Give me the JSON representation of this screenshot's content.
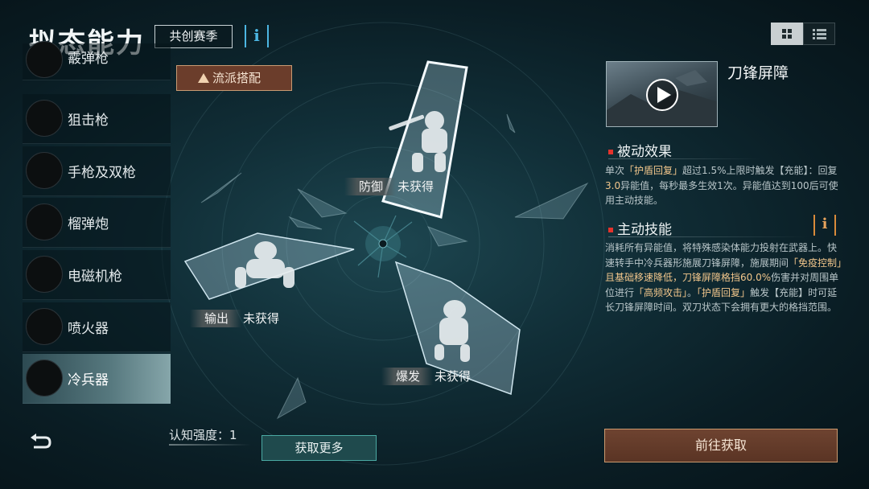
{
  "header": {
    "title": "拟态能力",
    "season_badge": "共创赛季",
    "info_icon": "info-icon"
  },
  "view_toggle": {
    "grid_icon": "grid-icon",
    "list_icon": "list-icon",
    "selected": "grid"
  },
  "sidebar": {
    "items": [
      {
        "label": "霰弹枪",
        "icon": "shotgun-icon",
        "active": false
      },
      {
        "label": "狙击枪",
        "icon": "sniper-rifle-icon",
        "active": false
      },
      {
        "label": "手枪及双枪",
        "icon": "dual-pistol-icon",
        "active": false
      },
      {
        "label": "榴弹炮",
        "icon": "grenade-launcher-icon",
        "active": false
      },
      {
        "label": "电磁机枪",
        "icon": "railgun-icon",
        "active": false
      },
      {
        "label": "喷火器",
        "icon": "flamethrower-icon",
        "active": false
      },
      {
        "label": "冷兵器",
        "icon": "sword-icon",
        "active": true
      }
    ]
  },
  "build_button": {
    "label": "流派搭配"
  },
  "crystals": [
    {
      "role": "防御",
      "status": "未获得"
    },
    {
      "role": "输出",
      "status": "未获得"
    },
    {
      "role": "爆发",
      "status": "未获得"
    }
  ],
  "cognition": {
    "label": "认知强度：",
    "value": "1"
  },
  "get_more_button": {
    "label": "获取更多"
  },
  "skill": {
    "name": "刀锋屏障",
    "passive": {
      "heading": "被动效果",
      "text_1": "单次",
      "hl_1": "「护盾回复」",
      "text_2": "超过1.5%上限时触发【充能】：回复",
      "hl_2": "3.0",
      "text_3": "异能值，每秒最多生效1次。异能值达到100后可使用主动技能。"
    },
    "active": {
      "heading": "主动技能",
      "text_1": "消耗所有异能值，将特殊感染体能力投射在武器上。快速转手中冷兵器形施展刀锋屏障，施展期间",
      "hl_1": "「免疫控制」且基础移速降低，刀锋屏障格挡60.0%",
      "text_2": "伤害并对周围单位进行",
      "hl_2": "「高频攻击」",
      "text_3": "。",
      "hl_3": "「护盾回复」",
      "text_4": "触发【充能】时可延长刀锋屏障时间。双刀状态下会拥有更大的格挡范围。"
    }
  },
  "acquire_button": {
    "label": "前往获取"
  },
  "back_icon": "back-arrow-icon",
  "play_icon": "play-icon",
  "colors": {
    "accent_orange": "#f3c78c",
    "red_dot": "#e4332c",
    "info_blue": "#4cb6e3"
  }
}
